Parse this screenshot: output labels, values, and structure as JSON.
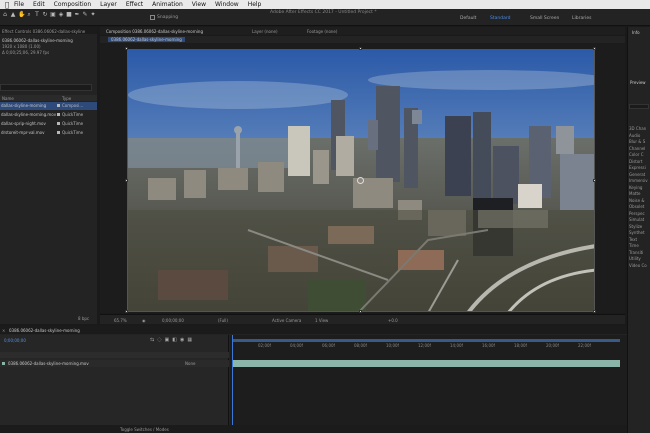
{
  "menubar": {
    "items": [
      "File",
      "Edit",
      "Composition",
      "Layer",
      "Effect",
      "Animation",
      "View",
      "Window",
      "Help"
    ]
  },
  "app": {
    "title": "Adobe After Effects CC 2017 - Untitled Project *",
    "snapping_label": "Snapping",
    "workspaces": [
      "Default",
      "Standard",
      "Small Screen",
      "Libraries"
    ],
    "active_workspace_index": 1
  },
  "project": {
    "tab_label": "Effect Controls 0386.06062-dallas-skyline",
    "item_name": "0386.06062-dallas-skyline-morning",
    "item_info": [
      "1920 x 1080 (1.00)",
      "Δ 0;00;25;06, 29.97 fps"
    ],
    "column_headers": [
      "Name",
      "Type"
    ],
    "rows": [
      {
        "name": "dallas-skyline-morning",
        "type": "Composi...",
        "selected": true
      },
      {
        "name": "dallas-skyline-morning.mov",
        "type": "QuickTime",
        "selected": false
      },
      {
        "name": "dallas-sprip-night.mov",
        "type": "QuickTime",
        "selected": false
      },
      {
        "name": "drstoreit-mpr-val.mov",
        "type": "QuickTime",
        "selected": false
      }
    ],
    "bpc_label": "8 bpc"
  },
  "composition": {
    "tabs": [
      "Composition 0386.06062-dallas-skyline-morning",
      "Layer (none)",
      "Footage (none)"
    ],
    "sub_tab": "0386.06062-dallas-skyline-morning",
    "footer": {
      "zoom": "65.7%",
      "timecode": "0;00;00;00",
      "resolution": "(Full)",
      "camera": "Active Camera",
      "views": "1 View",
      "exposure": "+0.0"
    }
  },
  "right_panel": {
    "tab_info": "Info",
    "tab_preview": "Preview",
    "effects": [
      "3D Chan",
      "Audio",
      "Blur & S",
      "Channel",
      "Color C",
      "Distort",
      "Expressi",
      "Generat",
      "Immersiv",
      "Keying",
      "Matte",
      "Noise &",
      "Obsolet",
      "Perspec",
      "Simulat",
      "Stylize",
      "Synthet",
      "Text",
      "Time",
      "Transiti",
      "Utility",
      "Video Co"
    ]
  },
  "timeline": {
    "tab_label": "0386.06062-dallas-skyline-morning",
    "timecode": "0;00;00;00",
    "layer_name": "0386.06062-dallas-skyline-morning.mov",
    "parent_value": "None",
    "ruler_ticks": [
      "02;00f",
      "04;00f",
      "06;00f",
      "08;00f",
      "10;00f",
      "12;00f",
      "14;00f",
      "16;00f",
      "18;00f",
      "20;00f",
      "22;00f"
    ],
    "bottom_label": "Toggle Switches / Modes"
  }
}
